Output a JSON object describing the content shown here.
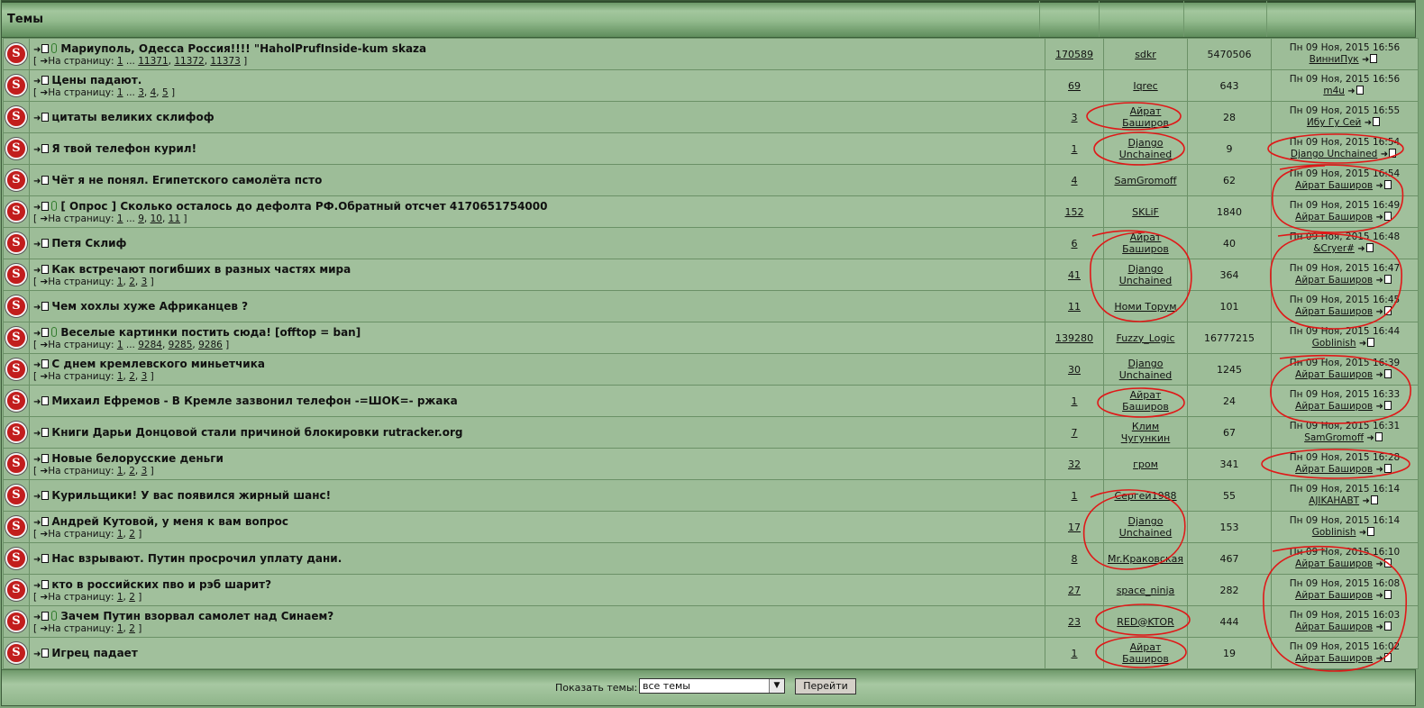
{
  "header": {
    "title": "Темы"
  },
  "pages_prefix": "На страницу:",
  "topics": [
    {
      "title": "Мариуполь, Одесса Россия!!!! \"HaholPrufInside-kum skaza",
      "clip": true,
      "pages": [
        "1",
        "...",
        "11371",
        "11372",
        "11373"
      ],
      "replies": "170589",
      "author": [
        "sdkr"
      ],
      "views": "5470506",
      "last_date": "Пн 09 Ноя, 2015 16:56",
      "last_user": "ВинниПук"
    },
    {
      "title": "Цены падают.",
      "clip": false,
      "pages": [
        "1",
        "...",
        "3",
        "4",
        "5"
      ],
      "replies": "69",
      "author": [
        "Iqrec"
      ],
      "views": "643",
      "last_date": "Пн 09 Ноя, 2015 16:56",
      "last_user": "m4u"
    },
    {
      "title": "цитаты великих склифоф",
      "clip": false,
      "pages": [],
      "replies": "3",
      "author": [
        "Айрат",
        "Баширов"
      ],
      "views": "28",
      "last_date": "Пн 09 Ноя, 2015 16:55",
      "last_user": "Ибу Гу Сей"
    },
    {
      "title": "Я твой телефон курил!",
      "clip": false,
      "pages": [],
      "replies": "1",
      "author": [
        "Django",
        "Unchained"
      ],
      "views": "9",
      "last_date": "Пн 09 Ноя, 2015 16:54",
      "last_user": "Django Unchained"
    },
    {
      "title": "Чёт я не понял. Египетского самолёта псто",
      "clip": false,
      "pages": [],
      "replies": "4",
      "author": [
        "SamGromoff"
      ],
      "views": "62",
      "last_date": "Пн 09 Ноя, 2015 16:54",
      "last_user": "Айрат Баширов"
    },
    {
      "title": "[ Опрос ] Сколько осталось до дефолта РФ.Обратный отсчет 4170651754000",
      "clip": true,
      "pages": [
        "1",
        "...",
        "9",
        "10",
        "11"
      ],
      "replies": "152",
      "author": [
        "SKLiF"
      ],
      "views": "1840",
      "last_date": "Пн 09 Ноя, 2015 16:49",
      "last_user": "Айрат Баширов"
    },
    {
      "title": "Петя Склиф",
      "clip": false,
      "pages": [],
      "replies": "6",
      "author": [
        "Айрат",
        "Баширов"
      ],
      "views": "40",
      "last_date": "Пн 09 Ноя, 2015 16:48",
      "last_user": "&Cryer#"
    },
    {
      "title": "Как встречают погибших в разных частях мира",
      "clip": false,
      "pages": [
        "1",
        "2",
        "3"
      ],
      "replies": "41",
      "author": [
        "Django",
        "Unchained"
      ],
      "views": "364",
      "last_date": "Пн 09 Ноя, 2015 16:47",
      "last_user": "Айрат Баширов"
    },
    {
      "title": "Чем хохлы хуже Африканцев ?",
      "clip": false,
      "pages": [],
      "replies": "11",
      "author": [
        "Номи Торум"
      ],
      "views": "101",
      "last_date": "Пн 09 Ноя, 2015 16:45",
      "last_user": "Айрат Баширов"
    },
    {
      "title": "Веселые картинки постить сюда! [offtop = ban]",
      "clip": true,
      "pages": [
        "1",
        "...",
        "9284",
        "9285",
        "9286"
      ],
      "replies": "139280",
      "author": [
        "Fuzzy_Logic"
      ],
      "views": "16777215",
      "last_date": "Пн 09 Ноя, 2015 16:44",
      "last_user": "Goblinish"
    },
    {
      "title": "С днем кремлевского миньетчика",
      "clip": false,
      "pages": [
        "1",
        "2",
        "3"
      ],
      "replies": "30",
      "author": [
        "Django",
        "Unchained"
      ],
      "views": "1245",
      "last_date": "Пн 09 Ноя, 2015 16:39",
      "last_user": "Айрат Баширов"
    },
    {
      "title": "Михаил Ефремов - В Кремле зазвонил телефон -=ШОК=- ржака",
      "clip": false,
      "pages": [],
      "replies": "1",
      "author": [
        "Айрат",
        "Баширов"
      ],
      "views": "24",
      "last_date": "Пн 09 Ноя, 2015 16:33",
      "last_user": "Айрат Баширов"
    },
    {
      "title": "Книги Дарьи Донцовой стали причиной блокировки rutracker.org",
      "clip": false,
      "pages": [],
      "replies": "7",
      "author": [
        "Клим",
        "Чугункин"
      ],
      "views": "67",
      "last_date": "Пн 09 Ноя, 2015 16:31",
      "last_user": "SamGromoff"
    },
    {
      "title": "Новые белорусские деньги",
      "clip": false,
      "pages": [
        "1",
        "2",
        "3"
      ],
      "replies": "32",
      "author": [
        "гром"
      ],
      "views": "341",
      "last_date": "Пн 09 Ноя, 2015 16:28",
      "last_user": "Айрат Баширов"
    },
    {
      "title": "Курильщики! У вас появился жирный шанс!",
      "clip": false,
      "pages": [],
      "replies": "1",
      "author": [
        "Сергей1988"
      ],
      "views": "55",
      "last_date": "Пн 09 Ноя, 2015 16:14",
      "last_user": "AJIKAHABT"
    },
    {
      "title": "Андрей Кутовой, у меня к вам вопрос",
      "clip": false,
      "pages": [
        "1",
        "2"
      ],
      "replies": "17",
      "author": [
        "Django",
        "Unchained"
      ],
      "views": "153",
      "last_date": "Пн 09 Ноя, 2015 16:14",
      "last_user": "Goblinish"
    },
    {
      "title": "Нас взрывают. Путин просрочил уплату дани.",
      "clip": false,
      "pages": [],
      "replies": "8",
      "author": [
        "Mr.Краковская"
      ],
      "views": "467",
      "last_date": "Пн 09 Ноя, 2015 16:10",
      "last_user": "Айрат Баширов"
    },
    {
      "title": "кто в российских пво и рэб шарит?",
      "clip": false,
      "pages": [
        "1",
        "2"
      ],
      "replies": "27",
      "author": [
        "space_ninja"
      ],
      "views": "282",
      "last_date": "Пн 09 Ноя, 2015 16:08",
      "last_user": "Айрат Баширов"
    },
    {
      "title": "Зачем Путин взорвал самолет над Синаем?",
      "clip": true,
      "pages": [
        "1",
        "2"
      ],
      "replies": "23",
      "author": [
        "RED@KTOR"
      ],
      "views": "444",
      "last_date": "Пн 09 Ноя, 2015 16:03",
      "last_user": "Айрат Баширов"
    },
    {
      "title": "Игрец падает",
      "clip": false,
      "pages": [],
      "replies": "1",
      "author": [
        "Айрат",
        "Баширов"
      ],
      "views": "19",
      "last_date": "Пн 09 Ноя, 2015 16:02",
      "last_user": "Айрат Баширов"
    }
  ],
  "footer": {
    "show_label": "Показать темы:",
    "select_value": "все темы",
    "go_button": "Перейти"
  },
  "annotation_color": "#e01818"
}
